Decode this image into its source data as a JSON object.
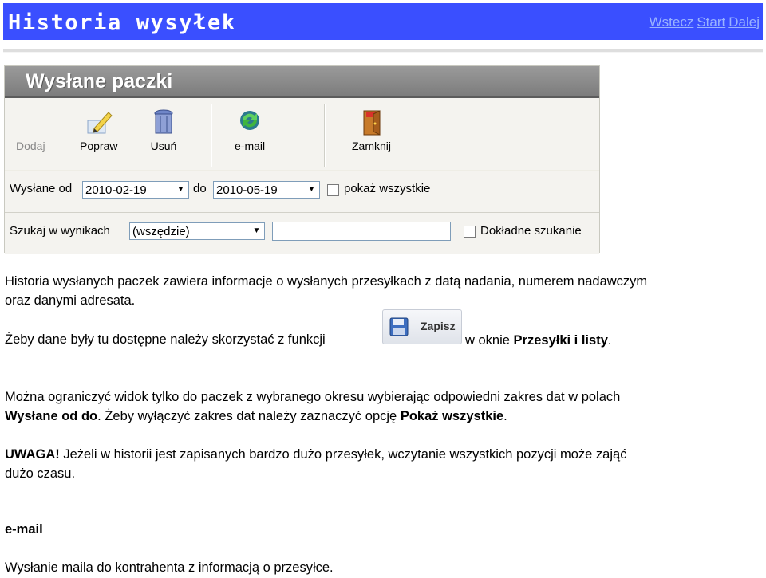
{
  "header": {
    "title": "Historia wysyłek",
    "nav": {
      "back": "Wstecz",
      "start": "Start",
      "next": "Dalej"
    }
  },
  "app": {
    "window_title": "Wysłane paczki",
    "toolbar": {
      "add": "Dodaj",
      "edit": "Popraw",
      "delete": "Usuń",
      "email": "e-mail",
      "close": "Zamknij"
    },
    "filter": {
      "sent_from_label": "Wysłane od",
      "date_from": "2010-02-19",
      "to_label": "do",
      "date_to": "2010-05-19",
      "show_all_label": "pokaż wszystkie",
      "search_label": "Szukaj w wynikach",
      "search_scope": "(wszędzie)",
      "search_value": "",
      "exact_label": "Dokładne szukanie"
    }
  },
  "content": {
    "para1_line1": "Historia wysłanych paczek zawiera informacje o wysłanych przesyłkach z datą nadania, numerem nadawczym",
    "para1_line2": "oraz danymi adresata.",
    "para2_pre": "Żeby dane były tu dostępne należy skorzystać z funkcji",
    "zapisz_label": "Zapisz",
    "para2_post": "w oknie",
    "para2_bold": "Przesyłki i listy",
    "para2_end": ".",
    "para3_line1": "Można ograniczyć widok tylko do paczek z wybranego okresu wybierając odpowiedni zakres dat w polach",
    "para3_bold1": "Wysłane od do",
    "para3_mid": ". Żeby wyłączyć zakres dat należy zaznaczyć opcję",
    "para3_bold2": "Pokaż wszystkie",
    "para3_end": ".",
    "warn_bold": "UWAGA!",
    "warn_text": " Jeżeli w historii jest zapisanych bardzo dużo przesyłek, wczytanie wszystkich pozycji może zająć",
    "warn_line2": "dużo czasu.",
    "email_heading": "e-mail",
    "email_text": "Wysłanie maila do kontrahenta z informacją o przesyłce."
  }
}
